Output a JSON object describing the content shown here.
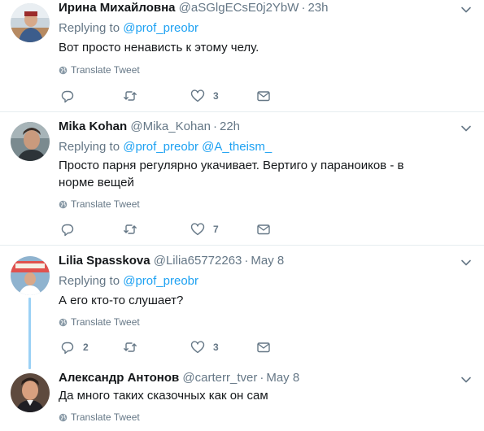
{
  "colors": {
    "link": "#1da1f2",
    "muted": "#657786",
    "text": "#14171a",
    "divider": "#e6ecf0",
    "thread_line": "#9bd1f5"
  },
  "tweets": [
    {
      "name": "Ирина Михайловна",
      "handle": "@aSGlgECsE0j2YbW",
      "time": "23h",
      "replying_prefix": "Replying to",
      "replying_to": "@prof_preobr",
      "replying_to_2": "",
      "text": "Вот просто ненависть к этому челу.",
      "translate": "Translate Tweet",
      "counts": {
        "reply": "",
        "retweet": "",
        "like": "3"
      }
    },
    {
      "name": "Mika Kohan",
      "handle": "@Mika_Kohan",
      "time": "22h",
      "replying_prefix": "Replying to",
      "replying_to": "@prof_preobr",
      "replying_to_2": "@A_theism_",
      "text": "Просто парня регулярно укачивает.  Вертиго у параноиков - в норме вещей",
      "translate": "Translate Tweet",
      "counts": {
        "reply": "",
        "retweet": "",
        "like": "7"
      }
    },
    {
      "name": "Lilia Spasskova",
      "handle": "@Lilia65772263",
      "time": "May 8",
      "replying_prefix": "Replying to",
      "replying_to": "@prof_preobr",
      "replying_to_2": "",
      "text": "А его кто-то слушает?",
      "translate": "Translate Tweet",
      "counts": {
        "reply": "2",
        "retweet": "",
        "like": "3"
      }
    },
    {
      "name": "Александр Антонов",
      "handle": "@carterr_tver",
      "time": "May 8",
      "text": "Да много таких сказочных как он сам",
      "translate": "Translate Tweet"
    }
  ]
}
